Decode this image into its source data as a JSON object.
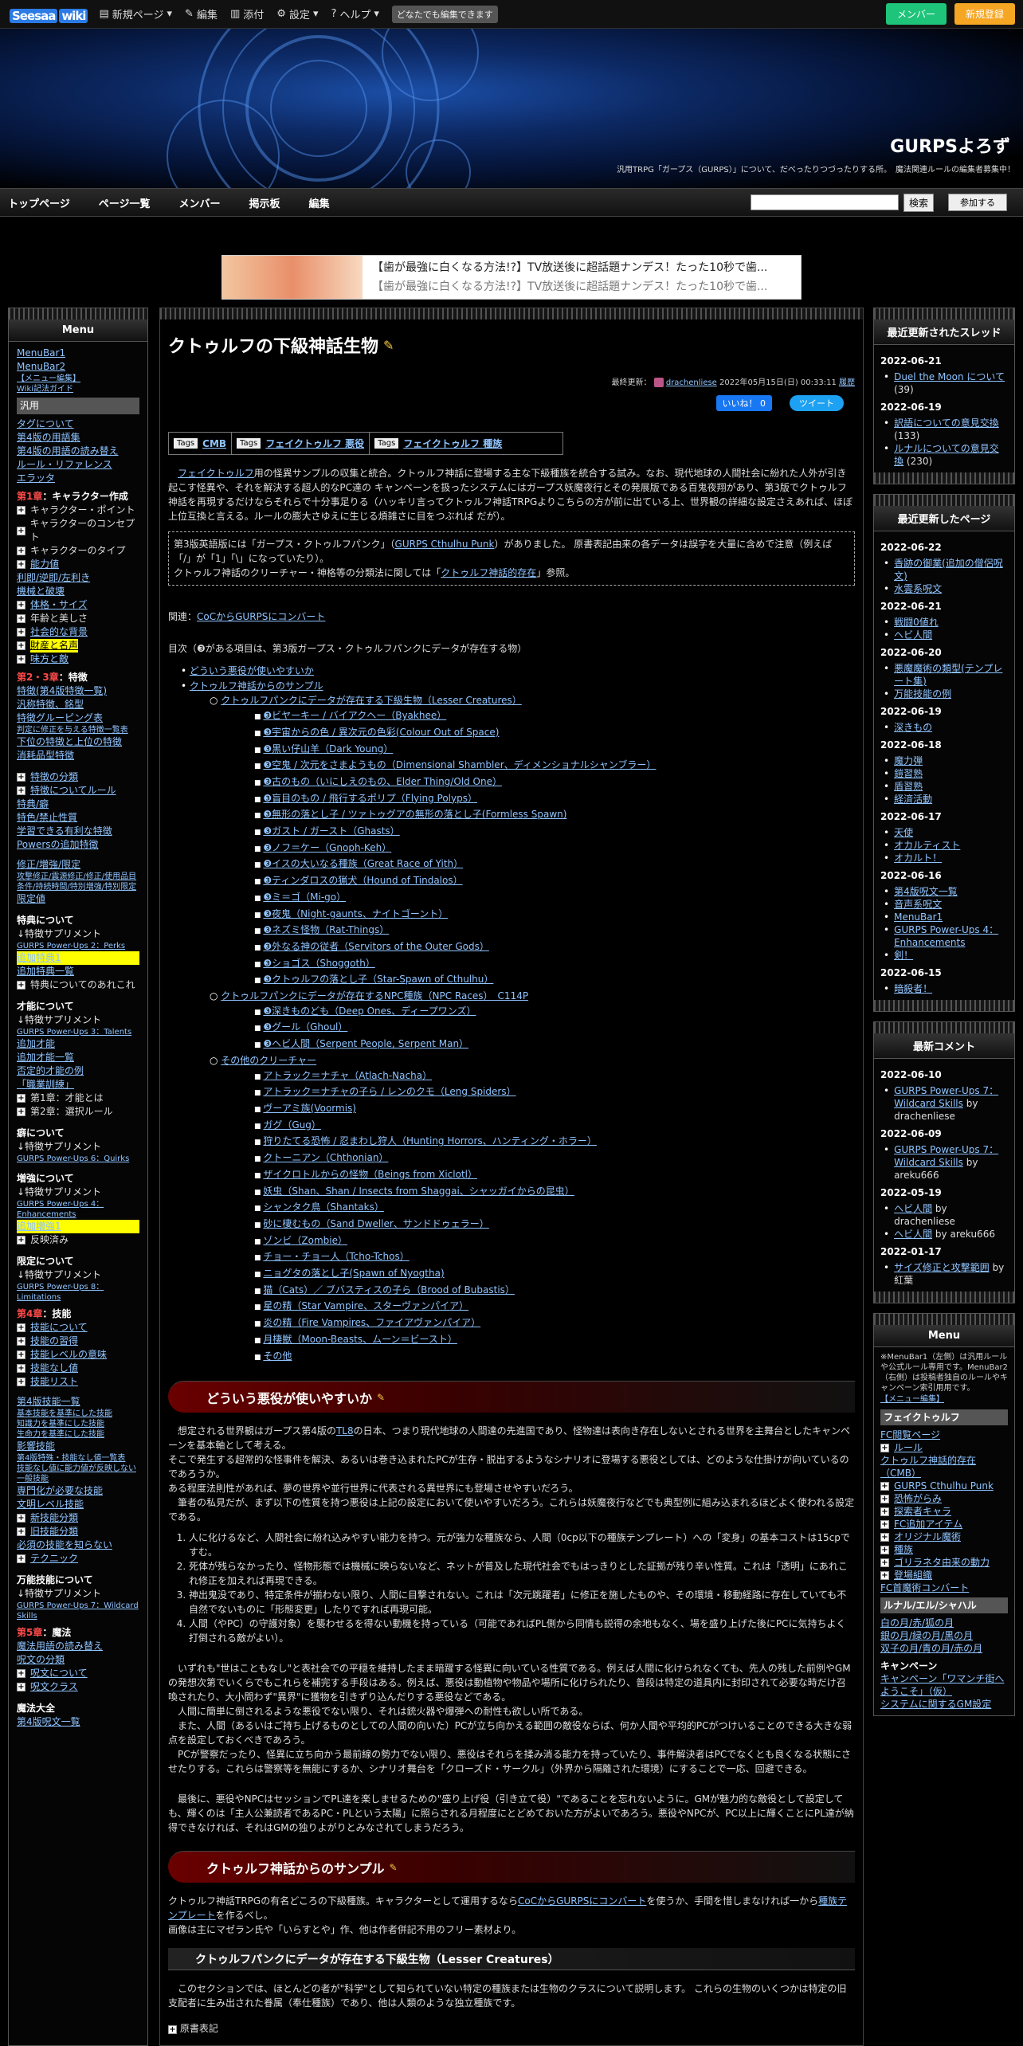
{
  "topbar": {
    "logo": "Seesaa",
    "logo_badge": "wiki",
    "items": [
      "新規ページ",
      "編集",
      "添付",
      "設定",
      "ヘルプ"
    ],
    "badge": "どなたでも編集できます",
    "btn_member": "メンバー",
    "btn_join": "新規登録"
  },
  "header": {
    "title": "GURPSよろず",
    "desc": "汎用TRPG「ガープス（GURPS）」について、だべったりつづったりする所。　魔法関連ルールの編集者募集中！"
  },
  "nav": {
    "items": [
      "トップページ",
      "ページ一覧",
      "メンバー",
      "掲示板",
      "編集"
    ],
    "search_btn": "検索",
    "join_btn": "参加する"
  },
  "ad": {
    "line1": "【歯が最強に白くなる方法!?】TV放送後に超話題ナンデス！たった10秒で歯...",
    "line2": "【歯が最強に白くなる方法!?】TV放送後に超話題ナンデス！たった10秒で歯..."
  },
  "left": {
    "title": "Menu",
    "links1": [
      "MenuBar1",
      "MenuBar2",
      "【メニュー編集】",
      "Wiki記法ガイド"
    ],
    "hd": "汎用",
    "links2": [
      "タグについて",
      "第4版の用語集",
      "第4版の用語の読み替え",
      "ルール・リファレンス",
      "エラッタ"
    ],
    "ch1": "第1章",
    "ch1t": "：キャラクター作成",
    "ch1items": [
      "キャラクター・ポイント",
      "キャラクターのコンセプト",
      "キャラクターのタイプ"
    ],
    "ch1b": [
      "能力値",
      "利即/逆即/左利き",
      "機械と破壊",
      "体格・サイズ",
      "年齢と美しさ",
      "社会的な背景",
      "財産と名声",
      "味方と敵"
    ],
    "ch2": "第2・3章",
    "ch2t": "：特徴",
    "ch2items": [
      "特徴(第4版特徴一覧)",
      "汎称特徴、銘型",
      "特徴グルーピング表",
      "判定に修正を与える特徴一覧表",
      "下位の特徴と上位の特徴",
      "消耗品型特徴"
    ],
    "ch2b": [
      "特徴の分類",
      "特徴についてルール",
      "特典/癖",
      "特色/禁止性質",
      "学習できる有利な特徴",
      "Powersの追加特徴"
    ],
    "mod": "修正/増強/限定",
    "mod2": "攻撃修正/震源修正/修正/使用品目条件/持続時間/特別増強/特別限定",
    "mod3": "限定値",
    "perk_h": "特典について",
    "perk1": "↓特徴サプリメント",
    "perk2": "GURPS Power-Ups 2：Perks",
    "perk3": "追加特典1",
    "perk4": "追加特典一覧",
    "perk5": "特典についてのあれこれ",
    "talent_h": "才能について",
    "talent1": "↓特徴サプリメント",
    "talent2": "GURPS Power-Ups 3：Talents",
    "talent3": "追加才能",
    "talent4": "追加才能一覧",
    "talent5": "否定的才能の例",
    "talent6": "「職業訓練」",
    "talent7": "第1章：才能とは",
    "talent8": "第2章：選択ルール",
    "quirk_h": "癖について",
    "quirk1": "↓特徴サプリメント",
    "quirk2": "GURPS Power-Ups 6：Quirks",
    "enh_h": "増強について",
    "enh1": "↓特徴サプリメント",
    "enh2": "GURPS Power-Ups 4：Enhancements",
    "enh3": "追加増強1",
    "enh4": "反映済み",
    "lim_h": "限定について",
    "lim1": "↓特徴サプリメント",
    "lim2": "GURPS Power-Ups 8：Limitations",
    "ch4": "第4章",
    "ch4t": "：技能",
    "ch4items": [
      "技能について",
      "技能の習得",
      "技能レベルの意味",
      "技能なし値",
      "技能リスト"
    ],
    "sk1": "第4版技能一覧",
    "sk2": "基本技能を基準にした技能",
    "sk3": "知識力を基準にした技能",
    "sk4": "生命力を基準にした技能",
    "sk5": "影響技能",
    "sk6": "第4版特殊・技能なし値一覧表",
    "sk7": "技能なし値に能力値が反映しない一般技能",
    "sk8": "専門化が必要な技能",
    "sk9": "文明レベル技能",
    "sk10": "新技能分類",
    "sk11": "旧技能分類",
    "sk12": "必須の技能を知らない",
    "sk13": "テクニック",
    "wild_h": "万能技能について",
    "wild1": "↓特徴サプリメント",
    "wild2": "GURPS Power-Ups 7：Wildcard Skills",
    "ch5": "第5章",
    "ch5t": "：魔法",
    "mag1": "魔法用語の読み替え",
    "mag2": "呪文の分類",
    "mag3": "呪文について",
    "mag4": "呪文クラス",
    "mag5": "魔法大全",
    "mag6": "第4版呪文一覧"
  },
  "right": {
    "box1": {
      "title": "最近更新されたスレッド",
      "groups": [
        {
          "date": "2022-06-21",
          "items": [
            {
              "t": "Duel the Moon について",
              "c": "(39)"
            }
          ]
        },
        {
          "date": "2022-06-19",
          "items": [
            {
              "t": "訳語についての意見交換",
              "c": "(133)"
            },
            {
              "t": "ルナルについての意見交換",
              "c": "(230)"
            }
          ]
        }
      ]
    },
    "box2": {
      "title": "最近更新したページ",
      "groups": [
        {
          "date": "2022-06-22",
          "items": [
            "香跡の御業(追加の僧侶呪文)",
            "水雲系呪文"
          ]
        },
        {
          "date": "2022-06-21",
          "items": [
            "戦闘0値れ",
            "ヘビ人間"
          ]
        },
        {
          "date": "2022-06-20",
          "items": [
            "悪魔魔術の類型(テンプレート集)",
            "万能技能の例"
          ]
        },
        {
          "date": "2022-06-19",
          "items": [
            "深きもの"
          ]
        },
        {
          "date": "2022-06-18",
          "items": [
            "魔力弾",
            "鎧習熟",
            "盾習熟",
            "経済活動"
          ]
        },
        {
          "date": "2022-06-17",
          "items": [
            "天使",
            "オカルティスト",
            "オカルト！"
          ]
        },
        {
          "date": "2022-06-16",
          "items": [
            "第4版呪文一覧",
            "音声系呪文",
            "MenuBar1",
            "GURPS Power-Ups 4：Enhancements",
            "剣！"
          ]
        },
        {
          "date": "2022-06-15",
          "items": [
            "暗殺者！"
          ]
        }
      ]
    },
    "box3": {
      "title": "最新コメント",
      "groups": [
        {
          "date": "2022-06-10",
          "items": [
            {
              "t": "GURPS Power-Ups 7：Wildcard Skills",
              "by": "by",
              "u": "drachenliese"
            }
          ]
        },
        {
          "date": "2022-06-09",
          "items": [
            {
              "t": "GURPS Power-Ups 7：Wildcard Skills",
              "by": "by",
              "u": "areku666"
            }
          ]
        },
        {
          "date": "2022-05-19",
          "items": [
            {
              "t": "ヘビ人間",
              "by": "by",
              "u": "drachenliese"
            },
            {
              "t": "ヘビ人間",
              "by": "by",
              "u": "areku666"
            }
          ]
        },
        {
          "date": "2022-01-17",
          "items": [
            {
              "t": "サイズ修正と攻撃範囲",
              "by": "by",
              "u": "紅葉"
            }
          ]
        }
      ]
    },
    "box4": {
      "title": "Menu",
      "desc": "※MenuBar1（左側）は汎用ルールや公式ルール専用です。MenuBar2（右側）は投稿者独自のルールやキャンペーン索引用用です。",
      "edit": "【メニュー編集】",
      "hd": "フェイクトゥルフ",
      "items": [
        "FC閲覧ページ",
        "ルール",
        "クトゥルフ神話的存在（CMB）",
        "GURPS Cthulhu Punk",
        "恐怖がらみ",
        "探索者キャラ",
        "FC追加アイテム",
        "オリジナル魔術",
        "種族",
        "ゴリラネタ由来の動力",
        "登場組織",
        "FC首魔術コンバート"
      ],
      "hd2": "ルナル/エル/シャハル",
      "items2": [
        "白の月/赤/狐の月",
        "銀の月/緑の月/黒の月",
        "双子の月/青の月/赤の月"
      ],
      "camp": "キャンペーン",
      "camp1": "キャンペーン「ワマンチ街へようこそ」（仮）",
      "camp2": "システムに関するGM設定"
    }
  },
  "main": {
    "title": "クトゥルフの下級神話生物",
    "meta_label": "最終更新：",
    "meta_user": "drachenliese",
    "meta_date": "2022年05月15日(日) 00:33:11",
    "meta_hist": "履歴",
    "fb": "いいね！ 0",
    "tw": "ツイート",
    "tags": [
      {
        "label": "Tags",
        "v": "CMB"
      },
      {
        "label": "Tags",
        "v": "フェイクトゥルフ 悪役"
      },
      {
        "label": "Tags",
        "v": "フェイクトゥルフ 種族"
      }
    ],
    "intro_link": "フェイクトゥルフ",
    "intro": "用の怪異サンプルの収集と統合。クトゥルフ神話に登場する主な下級種族を統合する試み。なお、現代地球の人間社会に紛れた人外が引き起こす怪異や、それを解決する超人的なPC達の キャンペーンを扱ったシステムにはガープス妖魔夜行とその発展版である百鬼夜翔があり、第3版でクトゥルフ神話を再現するだけならそれらで十分事足りる（ハッキリ言ってクトゥルフ神話TRPGよりこちらの方が前に出ている上、世界観の詳細な設定さえあれば、ほぼ上位互換と言える。ルールの膨大さゆえに生じる煩雑さに目をつぶれば だが）。",
    "note1": "第3版英語版には「ガープス・クトゥルフパンク」（",
    "note_link": "GURPS Cthulhu Punk",
    "note2": "）がありました。 原書表記由来の各データは誤字を大量に含めで注意（例えば「/」が「1」「\\」になっていたり）。",
    "note3": "クトゥルフ神話のクリーチャー・神格等の分類法に関しては「",
    "note_link2": "クトゥルフ神話的存在",
    "note4": "」参照。",
    "rel_label": "関連：",
    "rel_link": "CoCからGURPSにコンバート",
    "toc_label": "目次（❸がある項目は、第3版ガープス・クトゥルフパンクにデータが存在する物）",
    "toc1": [
      "どういう悪役が使いやすいか",
      "クトゥルフ神話からのサンプル"
    ],
    "toc2a": "クトゥルフパンクにデータが存在する下級生物（Lesser Creatures）",
    "toc3a": [
      "❸ビヤーキー / バイアクヘー（Byakhee）",
      "❸宇宙からの色 / 異次元の色彩(Colour Out of Space)",
      "❸黒い仔山羊（Dark Young）",
      "❸空鬼 / 次元をさまようもの（Dimensional Shambler、ディメンショナルシャンブラー）",
      "❸古のもの（いにしえのもの、Elder Thing/Old One）",
      "❸盲目のもの / 飛行するポリプ（Flying Polyps）",
      "❸無形の落とし子 / ツァトゥグアの無形の落とし子(Formless Spawn)",
      "❸ガスト / ガースト（Ghasts）",
      "❸ノフ＝ケー（Gnoph-Keh）",
      "❸イスの大いなる種族（Great Race of Yith）",
      "❸ティンダロスの猟犬（Hound of Tindalos）",
      "❸ミ＝ゴ（Mi-go）",
      "❸夜鬼（Night-gaunts、ナイトゴーント）",
      "❸ネズミ怪物（Rat-Things）",
      "❸外なる神の従者（Servitors of the Outer Gods）",
      "❸ショゴス（Shoggoth）",
      "❸クトゥルフの落とし子（Star-Spawn of Cthulhu）"
    ],
    "toc2b": "クトゥルフパンクにデータが存在するNPC種族（NPC Races）　C114P",
    "toc3b": [
      "❸深きものども（Deep Ones、ディープワンズ）",
      "❸グール（Ghoul）",
      "❸ヘビ人間（Serpent People, Serpent Man）"
    ],
    "toc2c": "その他のクリーチャー",
    "toc3c": [
      "アトラック＝ナチャ（Atlach-Nacha）",
      "アトラック＝ナチャの子ら / レンのクモ（Leng Spiders）",
      "ヴーアミ族(Voormis)",
      "ガグ（Gug）",
      "狩りたてる恐怖 / 忍まわし狩人（Hunting Horrors、ハンティング・ホラー）",
      "クトーニアン（Chthonian）",
      "ザイクロトルからの怪物（Beings from Xiclotl）",
      "妖虫（Shan、Shan / Insects from Shaggai、シャッガイからの昆虫）",
      "シャンタク鳥（Shantaks）",
      "砂に棲むもの（Sand Dweller、サンドドゥェラー）",
      "ゾンビ（Zombie）",
      "チョー・チョー人（Tcho-Tchos）",
      "ニョグタの落とし子(Spawn of Nyogtha)",
      "猫（Cats）／ ブバスティスの子ら（Brood of Bubastis）",
      "星の精（Star Vampire、スターヴァンパイア）",
      "炎の精（Fire Vampires、ファイアヴァンパイア）",
      "月棲獣（Moon-Beasts、ムーン＝ビースト）",
      "その他"
    ],
    "h2a": "どういう悪役が使いやすいか",
    "p1": "想定される世界観はガープス第4版の",
    "p1l": "TL8",
    "p1b": "の日本、つまり現代地球の人間達の先進国であり、怪物達は表向き存在しないとされる世界を主舞台としたキャンペーンを基本軸として考える。",
    "p2": "そこで発生する超常的な怪事件を解決、あるいは巻き込まれたPCが生存・脱出するようなシナリオに登場する悪役としては、どのような仕掛けが向いているのであろうか。",
    "p3": "ある程度法則性があれば、夢の世界や並行世界に代表される異世界にも登場させやすいだろう。",
    "p4": "筆者の私見だが、まず以下の性質を持つ悪役は上記の設定において使いやすいだろう。これらは妖魔夜行などでも典型例に組み込まれるほどよく使われる設定である。",
    "ol": [
      "人に化けるなど、人間社会に紛れ込みやすい能力を持つ。元が強力な種族なら、人間（0cp以下の種族テンプレート）への「変身」の基本コストは15cpですむ。",
      "死体が残らなかったり、怪物形態では機械に映らないなど、ネットが普及した現代社会でもはっきりとした証拠が残り辛い性質。これは「透明」にあれこれ修正を加えれば再現できる。",
      "神出鬼没であり、特定条件が揃わない限り、人間に目撃されない。これは「次元跳躍者」に修正を施したものや、その環境・移動経路に存在していても不自然でないものに「形態変更」したりですれば再現可能。",
      "人間（やPC）の守護対象）を襲わせるを得ない動機を持っている（可能であればPL側から同情も説得の余地もなく、場を盛り上げた後にPCに気持ちよく打倒される敵がよい）。"
    ],
    "p5": "いずれも\"世はこともなし\"と表社会での平穏を維持したまま暗躍する怪異に向いている性質である。例えば人間に化けられなくても、先人の残した前例やGMの発想次第でいくらでもこれらを補完する手段はある。例えば、悪役は動植物や物品や場所に化けられたり、普段は特定の道具内に封印されて必要な時だけ召喚されたり、大小問わず\"異界\"に獲物を引きずり込んだりする悪役などである。",
    "p6": "人間に簡単に倒されるような悪役でない限り、それは銃火器や爆弾への耐性も欲しい所である。",
    "p7": "また、人間（あるいはご持ち上げるものとしての人間の向いた）PCが立ち向かえる範囲の敵役ならば、何か人間や平均的PCがつけいることのできる大きな弱点を設定しておくべきであろう。",
    "p8": "PCが警察だったり、怪異に立ち向かう最前線の勢力でない限り、悪役はそれらを揉み消る能力を持っていたり、事件解決者はPCでなくとも良くなる状態にさせたりする。これらは警察等を無能にするか、シナリオ舞台を「クローズド・サークル」（外界から隔離された環境）にすることで一応、回避できる。",
    "p9": "最後に、悪役やNPCはセッションでPL達を楽しませるための\"盛り上げ役（引き立て役）\"であることを忘れないように。GMが魅力的な敵役として設定しても、輝くのは「主人公兼読者であるPC・PLという太陽」に照らされる月程度にとどめておいた方がよいであろう。悪役やNPCが、PC以上に輝くことにPL達が納得できなければ、それはGMの独りよがりとみなされてしまうだろう。",
    "h2b": "クトゥルフ神話からのサンプル",
    "p10": "クトゥルフ神話TRPGの有名どころの下級種族。キャラクターとして運用するなら",
    "p10l": "CoCからGURPSにコンバート",
    "p10b": "を使うか、手間を惜しまなければ一から",
    "p10l2": "種族テンプレート",
    "p10c": "を作るべし。",
    "p11": "画像は主にマゼラン氏や「いらすとや」作、他は作者併記不用のフリー素材より。",
    "h3a": "クトゥルフパンクにデータが存在する下級生物（Lesser Creatures）",
    "p12": "このセクションでは、ほとんどの者が\"科学\"として知られていない特定の種族または生物のクラスについて説明します。 これらの生物のいくつかは特定の旧支配者に生み出された眷属（奉仕種族）であり、他は人類のような独立種族です。",
    "p13": "原書表記"
  }
}
